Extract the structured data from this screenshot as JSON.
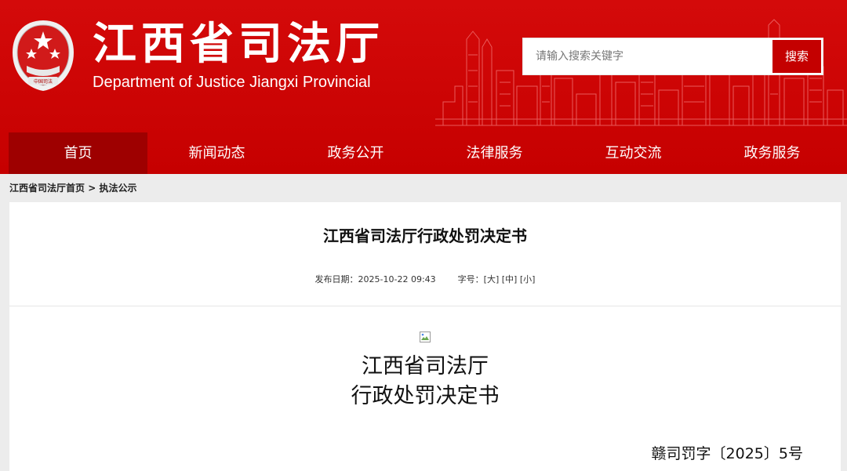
{
  "header": {
    "title": "江西省司法厅",
    "subtitle": "Department of Justice Jiangxi Provincial",
    "emblem_text": "中国司法",
    "search": {
      "placeholder": "请输入搜索关键字",
      "value": "",
      "button_label": "搜索"
    }
  },
  "nav": {
    "items": [
      {
        "label": "首页",
        "active": true
      },
      {
        "label": "新闻动态"
      },
      {
        "label": "政务公开"
      },
      {
        "label": "法律服务"
      },
      {
        "label": "互动交流"
      },
      {
        "label": "政务服务"
      }
    ]
  },
  "breadcrumb": {
    "home": "江西省司法厅首页",
    "separator": " > ",
    "current": "执法公示"
  },
  "article": {
    "title": "江西省司法厅行政处罚决定书",
    "publish_label": "发布日期：",
    "publish_date": "2025-10-22 09:43",
    "font_label": "字号：",
    "font_sizes": [
      "[大]",
      "[中]",
      "[小]"
    ],
    "body_line1": "江西省司法厅",
    "body_line2": "行政处罚决定书",
    "doc_number": "赣司罚字〔2025〕5号"
  },
  "colors": {
    "brand_red": "#c80000",
    "nav_active": "#9e0000",
    "page_bg": "#ececec"
  }
}
